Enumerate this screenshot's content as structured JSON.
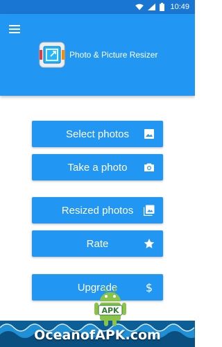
{
  "status_bar": {
    "time": "10:49",
    "icons": [
      "wifi-icon",
      "signal-icon",
      "battery-icon"
    ]
  },
  "app_bar": {
    "title": "Photo & Picture Resizer",
    "menu_icon": "hamburger-menu-icon",
    "logo_icon": "app-logo-icon",
    "color": "#2196F3",
    "status_color": "#1976D2"
  },
  "buttons": {
    "select_photos": {
      "label": "Select photos",
      "icon": "image-icon"
    },
    "take_photo": {
      "label": "Take a photo",
      "icon": "camera-icon"
    },
    "resized_photos": {
      "label": "Resized photos",
      "icon": "photo-library-icon"
    },
    "rate": {
      "label": "Rate",
      "icon": "star-icon"
    },
    "upgrade": {
      "label": "Upgrade",
      "icon": "dollar-icon"
    }
  },
  "watermark": {
    "text": "OceanofAPK.com",
    "badge": "APK",
    "icon": "android-robot-icon"
  }
}
